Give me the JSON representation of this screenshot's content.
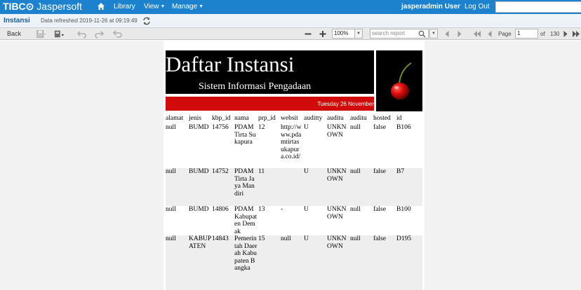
{
  "topnav": {
    "brand_tibco": "TIBC⊙",
    "brand_name": "Jaspersoft",
    "library": "Library",
    "view": "View",
    "manage": "Manage",
    "user": "jasperadmin User",
    "logout": "Log Out"
  },
  "titlebar": {
    "title": "Instansi",
    "refreshed": "Data refreshed 2019-11-26 at 09:19:49"
  },
  "toolbar": {
    "back": "Back",
    "zoom": "100%",
    "search_placeholder": "search report",
    "page_label": "Page",
    "page_value": "1",
    "of_label": "of",
    "total_pages": "130"
  },
  "report": {
    "title": "Daftar Instansi",
    "subtitle": "Sistem Informasi Pengadaan",
    "date": "Tuesday 26 November",
    "columns": [
      "alamat",
      "jenis",
      "kbp_id",
      "nama",
      "prp_id",
      "websit",
      "auditty",
      "auditu",
      "auditu",
      "hosted",
      "id"
    ],
    "rows": [
      [
        "null",
        "BUMD",
        "14756",
        "PDAM Tirta Sukapura",
        "12",
        "http://www.pdamtirtasukapura.co.id/",
        "U",
        "UNKNOWN",
        "null",
        "false",
        "B106"
      ],
      [
        "null",
        "BUMD",
        "14752",
        "PDAM Tirta Jaya Mandiri",
        "11",
        "",
        "U",
        "UNKNOWN",
        "null",
        "false",
        "B7"
      ],
      [
        "null",
        "BUMD",
        "14806",
        "PDAM Kabupaten Demak",
        "13",
        "-",
        "U",
        "UNKNOWN",
        "null",
        "false",
        "B100"
      ],
      [
        "null",
        "KABUPATEN",
        "14843",
        "Pemerintah Daerah Kabupaten Bangka",
        "15",
        "null",
        "U",
        "UNKNOWN",
        "null",
        "false",
        "D195"
      ]
    ]
  },
  "colors": {
    "nav_blue": "#1d82ce",
    "header_red": "#d10a0a",
    "title_blue": "#1a5c96"
  },
  "icons": [
    "home-icon",
    "refresh-icon",
    "save-icon",
    "export-icon",
    "undo-icon",
    "redo-icon",
    "undo-all-icon",
    "zoom-out-icon",
    "zoom-in-icon",
    "search-icon",
    "prev-result-icon",
    "next-result-icon",
    "first-page-icon",
    "prev-page-icon",
    "next-page-icon",
    "last-page-icon",
    "cherry-image"
  ]
}
